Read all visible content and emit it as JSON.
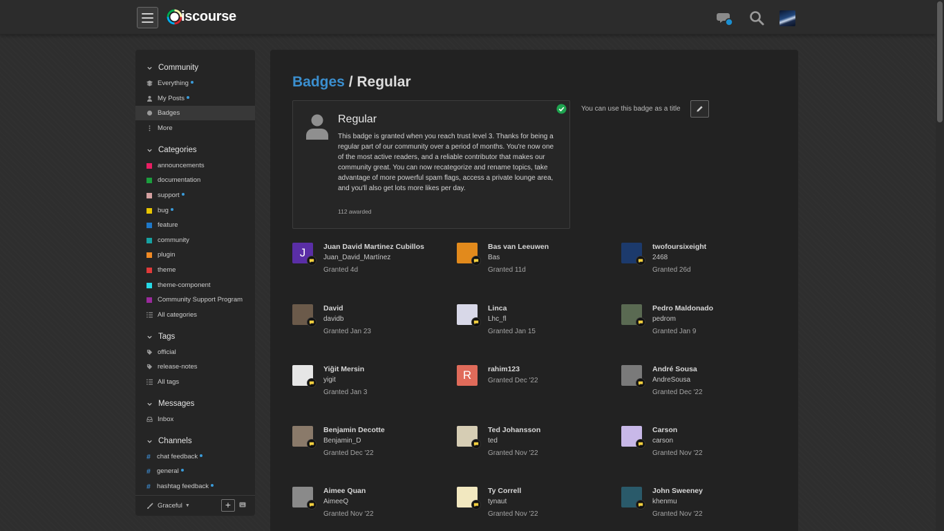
{
  "header": {
    "logo_text": "iscourse",
    "chat_icon": "chat-bubble-icon",
    "search_icon": "search-icon"
  },
  "sidebar": {
    "sections": [
      {
        "title": "Community",
        "items": [
          {
            "label": "Everything",
            "icon": "layers-icon",
            "dot": true
          },
          {
            "label": "My Posts",
            "icon": "user-icon",
            "dot": true
          },
          {
            "label": "Badges",
            "icon": "certificate-icon",
            "dot": false,
            "active": true
          },
          {
            "label": "More",
            "icon": "ellipsis-vertical-icon",
            "dot": false
          }
        ]
      },
      {
        "title": "Categories",
        "items": [
          {
            "label": "announcements",
            "color": "#e91e63"
          },
          {
            "label": "documentation",
            "color": "#1b9e3e"
          },
          {
            "label": "support",
            "color": "#d4a0a0",
            "dot": true
          },
          {
            "label": "bug",
            "color": "#e8c500",
            "dot": true
          },
          {
            "label": "feature",
            "color": "#1e78c8"
          },
          {
            "label": "community",
            "color": "#17a2a2"
          },
          {
            "label": "plugin",
            "color": "#f08a24"
          },
          {
            "label": "theme",
            "color": "#e03a3a"
          },
          {
            "label": "theme-component",
            "color": "#26d9e6"
          },
          {
            "label": "Community Support Program",
            "color": "#9a2a9c"
          },
          {
            "label": "All categories",
            "icon": "list-icon"
          }
        ]
      },
      {
        "title": "Tags",
        "items": [
          {
            "label": "official",
            "icon": "tag-icon"
          },
          {
            "label": "release-notes",
            "icon": "tag-icon"
          },
          {
            "label": "All tags",
            "icon": "list-icon"
          }
        ]
      },
      {
        "title": "Messages",
        "items": [
          {
            "label": "Inbox",
            "icon": "inbox-icon"
          }
        ]
      },
      {
        "title": "Channels",
        "items": [
          {
            "label": "chat feedback",
            "dot": true
          },
          {
            "label": "general",
            "dot": true
          },
          {
            "label": "hashtag feedback",
            "dot": true
          }
        ]
      }
    ],
    "footer": {
      "theme_label": "Graceful"
    }
  },
  "main": {
    "breadcrumb": "Badges",
    "separator": " / ",
    "title": "Regular",
    "badge": {
      "name": "Regular",
      "description": "This badge is granted when you reach trust level 3. Thanks for being a regular part of our community over a period of months. You're now one of the most active readers, and a reliable contributor that makes our community great. You can now recategorize and rename topics, take advantage of more powerful spam flags, access a private lounge area, and you'll also get lots more likes per day.",
      "awarded": "112 awarded"
    },
    "title_note": "You can use this badge as a title",
    "grantees": [
      {
        "name": "Juan David Martinez Cubillos",
        "username": "Juan_David_Martínez",
        "date": "Granted 4d",
        "avatar_letter": "J",
        "avatar_bg": "#5a2ea6"
      },
      {
        "name": "Bas van Leeuwen",
        "username": "Bas",
        "date": "Granted 11d",
        "avatar_bg": "#e28a1c"
      },
      {
        "name": "twofoursixeight",
        "username": "2468",
        "date": "Granted 26d",
        "avatar_bg": "#1c3a6c"
      },
      {
        "name": "David",
        "username": "davidb",
        "date": "Granted Jan 23",
        "avatar_bg": "#6b5a4a"
      },
      {
        "name": "Linca",
        "username": "Lhc_fl",
        "date": "Granted Jan 15",
        "avatar_bg": "#d8d8e8"
      },
      {
        "name": "Pedro Maldonado",
        "username": "pedrom",
        "date": "Granted Jan 9",
        "avatar_bg": "#5a6a52"
      },
      {
        "name": "Yiğit Mersin",
        "username": "yigit",
        "date": "Granted Jan 3",
        "avatar_bg": "#e6e6e6"
      },
      {
        "name": "rahim123",
        "username": "",
        "date": "Granted Dec '22",
        "avatar_letter": "R",
        "avatar_bg": "#e06b5a"
      },
      {
        "name": "André Sousa",
        "username": "AndreSousa",
        "date": "Granted Dec '22",
        "avatar_bg": "#7a7a7a"
      },
      {
        "name": "Benjamin Decotte",
        "username": "Benjamin_D",
        "date": "Granted Dec '22",
        "avatar_bg": "#8a7a6a"
      },
      {
        "name": "Ted Johansson",
        "username": "ted",
        "date": "Granted Nov '22",
        "avatar_bg": "#d6cdb4"
      },
      {
        "name": "Carson",
        "username": "carson",
        "date": "Granted Nov '22",
        "avatar_bg": "#c8b8e8"
      },
      {
        "name": "Aimee Quan",
        "username": "AimeeQ",
        "date": "Granted Nov '22",
        "avatar_bg": "#8a8a8a"
      },
      {
        "name": "Ty Correll",
        "username": "tynaut",
        "date": "Granted Nov '22",
        "avatar_bg": "#f2e8c0"
      },
      {
        "name": "John Sweeney",
        "username": "khenmu",
        "date": "Granted Nov '22",
        "avatar_bg": "#2a5a6a"
      }
    ]
  }
}
